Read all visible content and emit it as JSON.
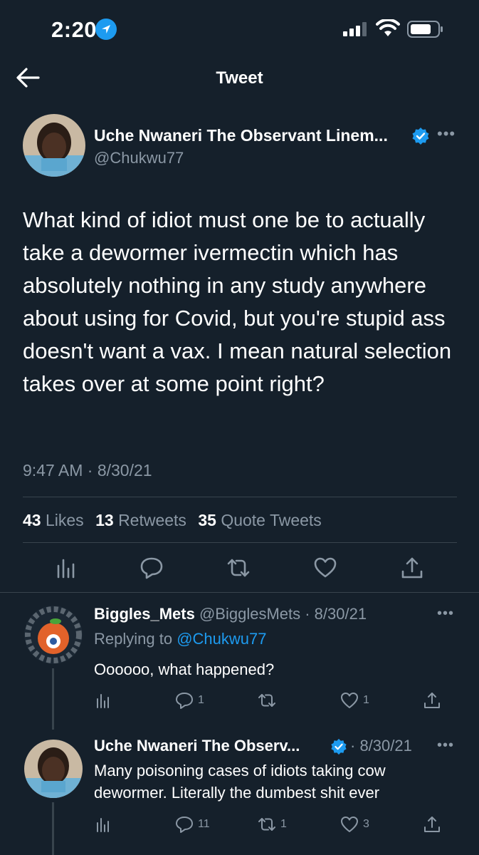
{
  "status_bar": {
    "time": "2:20"
  },
  "header": {
    "title": "Tweet"
  },
  "main_tweet": {
    "author_name": "Uche Nwaneri The Observant Linem...",
    "handle": "@Chukwu77",
    "text": "What kind of idiot must one be to actually take a dewormer ivermectin which has absolutely nothing in any study anywhere about using for Covid, but you're stupid ass doesn't want a vax. I mean natural selection takes over at some point right?",
    "timestamp": "9:47 AM · 8/30/21",
    "stats": {
      "likes_count": "43",
      "likes_label": "Likes",
      "retweets_count": "13",
      "retweets_label": "Retweets",
      "quotes_count": "35",
      "quotes_label": "Quote Tweets"
    }
  },
  "replies": [
    {
      "name": "Biggles_Mets",
      "handle_date": "@BigglesMets · 8/30/21",
      "replying_prefix": "Replying to",
      "replying_to": "@Chukwu77",
      "text": "Oooooo, what happened?",
      "reply_count": "1",
      "retweet_count": "",
      "like_count": "1"
    },
    {
      "name": "Uche Nwaneri The Observ...",
      "date": "· 8/30/21",
      "text": "Many poisoning cases of idiots taking cow dewormer. Literally the dumbest shit ever",
      "reply_count": "11",
      "retweet_count": "1",
      "like_count": "3"
    }
  ],
  "colors": {
    "background": "#15202b",
    "accent": "#1d9bf0",
    "muted": "#8b98a5",
    "divider": "#38444d"
  },
  "icons": [
    "location-arrow-icon",
    "signal-icon",
    "wifi-icon",
    "battery-icon",
    "back-arrow-icon",
    "verified-badge-icon",
    "more-icon",
    "analytics-icon",
    "reply-icon",
    "retweet-icon",
    "like-icon",
    "share-icon"
  ]
}
